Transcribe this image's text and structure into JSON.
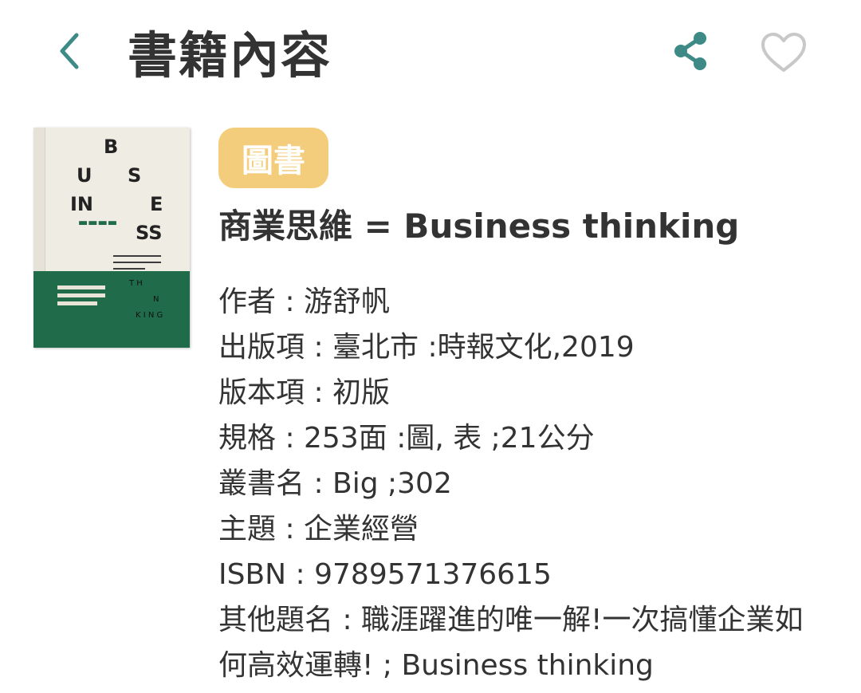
{
  "header": {
    "title": "書籍內容",
    "back_icon": "chevron-left-icon",
    "share_icon": "share-icon",
    "favorite_icon": "heart-outline-icon"
  },
  "colors": {
    "accent": "#3d8a87",
    "tag_bg": "#f3cd7b",
    "text": "#333333"
  },
  "book": {
    "type_tag": "圖書",
    "title": "商業思維 = Business thinking",
    "details": [
      {
        "label": "作者",
        "value": "游舒帆"
      },
      {
        "label": "出版項",
        "value": "臺北市 :時報文化,2019"
      },
      {
        "label": "版本項",
        "value": "初版"
      },
      {
        "label": "規格",
        "value": "253面 :圖, 表 ;21公分"
      },
      {
        "label": "叢書名",
        "value": "Big ;302"
      },
      {
        "label": "主題",
        "value": "企業經營"
      },
      {
        "label": "ISBN",
        "value": "9789571376615"
      },
      {
        "label": "其他題名",
        "value": "職涯躍進的唯一解!一次搞懂企業如何高效運轉! ; Business thinking"
      }
    ]
  }
}
